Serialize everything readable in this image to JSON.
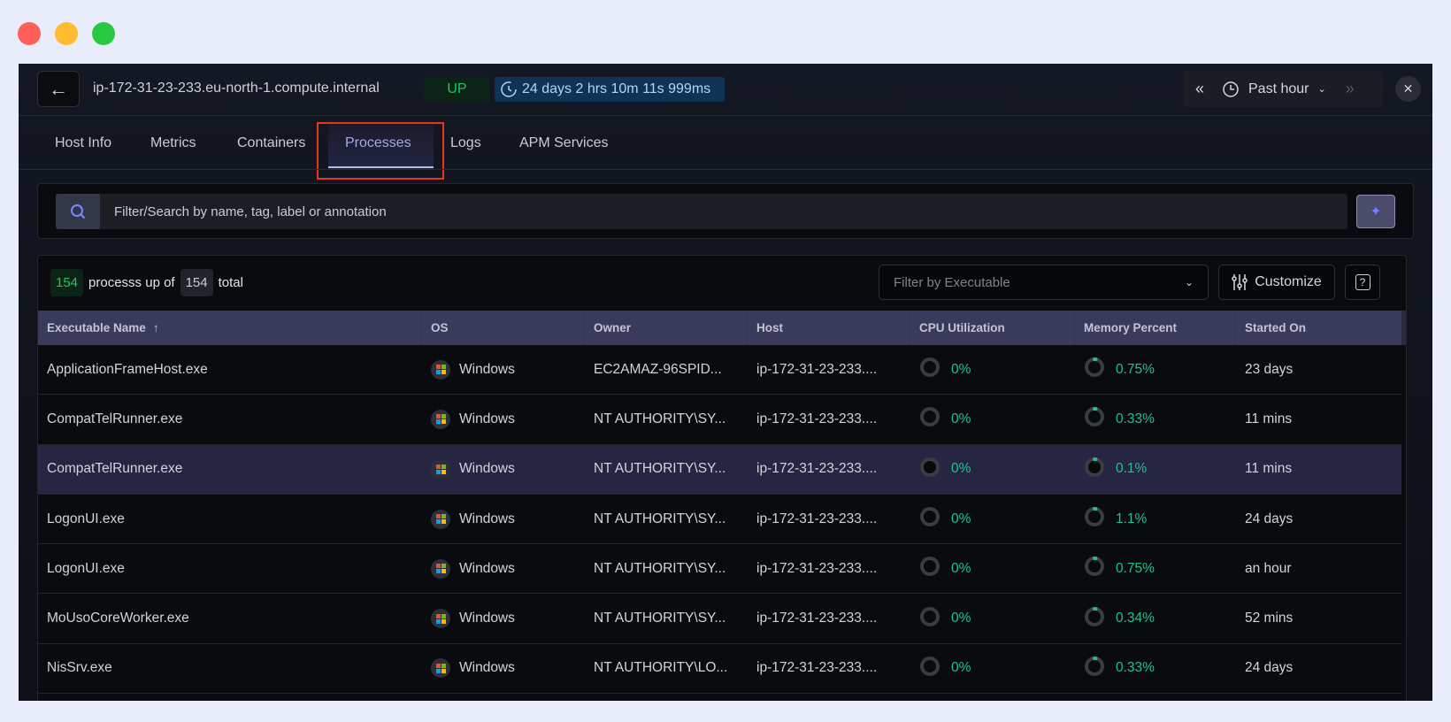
{
  "window": {
    "traffic_lights": [
      "#fe5f57",
      "#febc2e",
      "#28c840"
    ]
  },
  "header": {
    "hostname": "ip-172-31-23-233.eu-north-1.compute.internal",
    "status": "UP",
    "uptime": "24 days 2 hrs 10m 11s 999ms",
    "time_range": "Past hour"
  },
  "tabs": [
    "Host Info",
    "Metrics",
    "Containers",
    "Processes",
    "Logs",
    "APM Services"
  ],
  "active_tab": "Processes",
  "search": {
    "placeholder": "Filter/Search by name, tag, label or annotation"
  },
  "summary": {
    "up_count": "154",
    "text_mid": "processs up of",
    "total": "154",
    "text_end": "total"
  },
  "toolbar": {
    "filter_placeholder": "Filter by Executable",
    "customize": "Customize",
    "help": "?"
  },
  "table": {
    "columns": [
      "Executable Name",
      "OS",
      "Owner",
      "Host",
      "CPU Utilization",
      "Memory Percent",
      "Started On"
    ],
    "sort_indicator": "↑",
    "rows": [
      {
        "name": "ApplicationFrameHost.exe",
        "os": "Windows",
        "owner": "EC2AMAZ-96SPID...",
        "host": "ip-172-31-23-233....",
        "cpu": "0%",
        "cpu_value": 0,
        "mem": "0.75%",
        "mem_value": 0.75,
        "started": "23 days"
      },
      {
        "name": "CompatTelRunner.exe",
        "os": "Windows",
        "owner": "NT AUTHORITY\\SY...",
        "host": "ip-172-31-23-233....",
        "cpu": "0%",
        "cpu_value": 0,
        "mem": "0.33%",
        "mem_value": 0.33,
        "started": "11 mins"
      },
      {
        "name": "CompatTelRunner.exe",
        "os": "Windows",
        "owner": "NT AUTHORITY\\SY...",
        "host": "ip-172-31-23-233....",
        "cpu": "0%",
        "cpu_value": 0,
        "mem": "0.1%",
        "mem_value": 0.1,
        "started": "11 mins",
        "selected": true
      },
      {
        "name": "LogonUI.exe",
        "os": "Windows",
        "owner": "NT AUTHORITY\\SY...",
        "host": "ip-172-31-23-233....",
        "cpu": "0%",
        "cpu_value": 0,
        "mem": "1.1%",
        "mem_value": 1.1,
        "started": "24 days"
      },
      {
        "name": "LogonUI.exe",
        "os": "Windows",
        "owner": "NT AUTHORITY\\SY...",
        "host": "ip-172-31-23-233....",
        "cpu": "0%",
        "cpu_value": 0,
        "mem": "0.75%",
        "mem_value": 0.75,
        "started": "an hour"
      },
      {
        "name": "MoUsoCoreWorker.exe",
        "os": "Windows",
        "owner": "NT AUTHORITY\\SY...",
        "host": "ip-172-31-23-233....",
        "cpu": "0%",
        "cpu_value": 0,
        "mem": "0.34%",
        "mem_value": 0.34,
        "started": "52 mins"
      },
      {
        "name": "NisSrv.exe",
        "os": "Windows",
        "owner": "NT AUTHORITY\\LO...",
        "host": "ip-172-31-23-233....",
        "cpu": "0%",
        "cpu_value": 0,
        "mem": "0.33%",
        "mem_value": 0.33,
        "started": "24 days"
      }
    ]
  }
}
